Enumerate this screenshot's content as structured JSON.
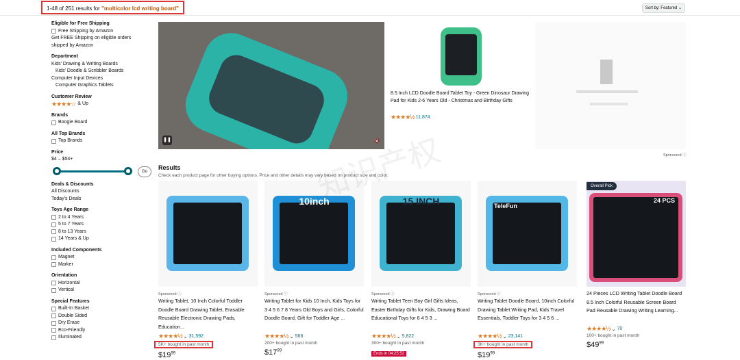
{
  "topbar": {
    "results_prefix": "1-48 of 251 results for ",
    "query": "\"multicolor lcd writing board\"",
    "sort_label": "Sort by:",
    "sort_value": "Featured"
  },
  "sidebar": {
    "free_shipping": {
      "heading": "Eligible for Free Shipping",
      "option": "Free Shipping by Amazon",
      "note": "Get FREE Shipping on eligible orders shipped by Amazon"
    },
    "department": {
      "heading": "Department",
      "items": [
        "Kids' Drawing & Writing Boards",
        "Kids' Doodle & Scribbler Boards",
        "Computer Input Devices",
        "Computer Graphics Tablets"
      ]
    },
    "review": {
      "heading": "Customer Review",
      "stars": "★★★★☆",
      "label": "& Up"
    },
    "brands": {
      "heading": "Brands",
      "option": "Boogie Board"
    },
    "top_brands": {
      "heading": "All Top Brands",
      "option": "Top Brands"
    },
    "price": {
      "heading": "Price",
      "range": "$4 – $54+",
      "go": "Go"
    },
    "deals": {
      "heading": "Deals & Discounts",
      "items": [
        "All Discounts",
        "Today's Deals"
      ]
    },
    "age": {
      "heading": "Toys Age Range",
      "items": [
        "2 to 4 Years",
        "5 to 7 Years",
        "8 to 13 Years",
        "14 Years & Up"
      ]
    },
    "components": {
      "heading": "Included Components",
      "items": [
        "Magnet",
        "Marker"
      ]
    },
    "orientation": {
      "heading": "Orientation",
      "items": [
        "Horizontal",
        "Vertical"
      ]
    },
    "features": {
      "heading": "Special Features",
      "items": [
        "Built-In Basket",
        "Double Sided",
        "Dry Erase",
        "Eco-Friendly",
        "Illuminated"
      ]
    }
  },
  "banner": {
    "title": "8.5 Inch LCD Doodle Board Tablet Toy - Green Dinosaur Drawing Pad for Kids 2-6 Years Old - Christmas and Birthday Gifts",
    "stars": "★★★★½",
    "reviews": "11,874",
    "sponsored": "Sponsored"
  },
  "results": {
    "heading": "Results",
    "subtitle": "Check each product page for other buying options. Price and other details may vary based on product size and color."
  },
  "products": [
    {
      "sponsored": "Sponsored",
      "title": "Writing Tablet, 10 Inch Colorful Toddler Doodle Board Drawing Tablet, Erasable Reusable Electronic Drawing Pads, Education...",
      "stars": "★★★★½",
      "reviews": "31,592",
      "bought": "5K+ bought in past month",
      "price_whole": "$19",
      "price_frac": "99"
    },
    {
      "headline": "10inch",
      "sponsored": "Sponsored",
      "title": "Writing Tablet for Kids 10 Inch, Kids Toys for 3 4 5 6 7 8 Years Old Boys and Girls, Colorful Doodle Board, Gift for Toddler Age ...",
      "stars": "★★★★½",
      "reviews": "566",
      "bought": "200+ bought in past month",
      "price_whole": "$17",
      "price_frac": "99"
    },
    {
      "headline": "15 INCH",
      "sponsored": "Sponsored",
      "title": "Writing Tablet Teen Boy Girl Gifts Ideas, Easter Birthday Gifts for Kids, Drawing Board Educational Toys for 6 4 5 3 ...",
      "stars": "★★★★½",
      "reviews": "5,822",
      "bought": "300+ bought in past month",
      "deal": "Ends in 04:25:52"
    },
    {
      "headline": "TeleFun",
      "sponsored": "Sponsored",
      "title": "Writing Tablet Doodle Board, 10inch Colorful Drawing Tablet Writing Pad, Kids Travel Essentials, Toddler Toys for 3 4 5 6 ...",
      "stars": "★★★★½",
      "reviews": "23,141",
      "bought": "3K+ bought in past month",
      "price_whole": "$19",
      "price_frac": "99"
    },
    {
      "badge": "Overall Pick",
      "headline": "24 PCS",
      "title": "24 Pieces LCD Writing Tablet Doodle Board 8.5 Inch Colorful Reusable Screen Board Pad Reusable Drawing Writing Learning...",
      "stars": "★★★★½",
      "reviews": "70",
      "bought": "100+ bought in past month",
      "price_whole": "$49",
      "price_frac": "99"
    }
  ],
  "watermark": "知识产权"
}
